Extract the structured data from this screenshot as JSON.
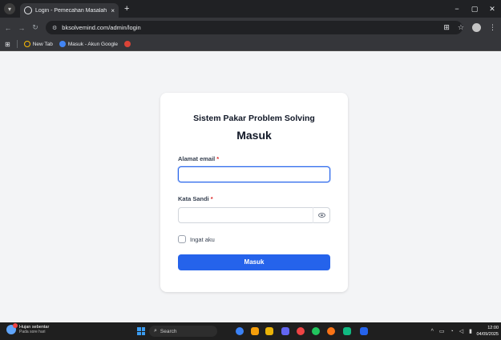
{
  "browser": {
    "tab_title": "Login - Pemecahan Masalah Si",
    "tab_close": "×",
    "new_tab": "+",
    "url": "bksolvemind.com/admin/login",
    "bookmarks": [
      {
        "label": "New Tab",
        "color": "#fbbc04"
      },
      {
        "label": "Masuk - Akun Google",
        "color": "#4285f4"
      }
    ],
    "window_controls": [
      "−",
      "▢",
      "✕"
    ]
  },
  "login": {
    "app_title": "Sistem Pakar Problem Solving",
    "heading": "Masuk",
    "email_label": "Alamat email",
    "required_mark": "*",
    "email_value": "",
    "password_label": "Kata Sandi",
    "password_value": "",
    "remember_label": "Ingat aku",
    "remember_checked": false,
    "submit_label": "Masuk",
    "accent_color": "#2563eb"
  },
  "taskbar": {
    "weather_title": "Hujan sebentar",
    "weather_subtitle": "Pada sore hari",
    "search_label": "Search",
    "time": "12:00",
    "date": "04/09/2025",
    "pinned_icons": [
      "edge-icon",
      "chat-icon",
      "folder-icon",
      "calendar-icon",
      "chrome-icon",
      "whatsapp-icon",
      "photos-icon",
      "store-icon",
      "word-icon"
    ]
  }
}
